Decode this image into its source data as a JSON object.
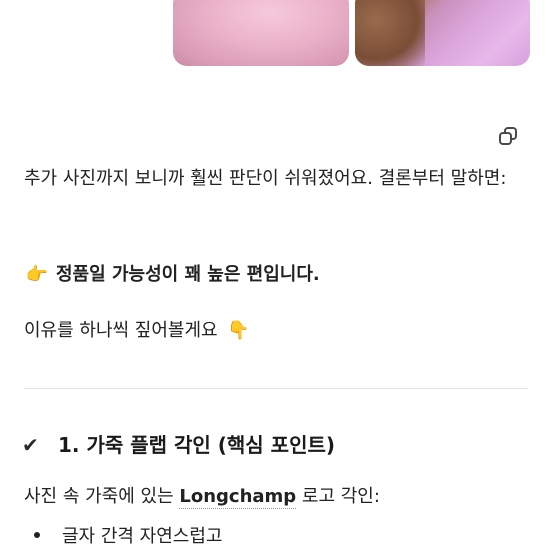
{
  "photos": [
    {
      "alt": "pink bag close-up"
    },
    {
      "alt": "hand holding pink bag"
    }
  ],
  "message": {
    "copy_icon": "copy-icon",
    "intro": "추가 사진까지 보니까 훨씬 판단이 쉬워졌어요. 결론부터 말하면:",
    "verdict_emoji": "👉",
    "verdict": "정품일 가능성이 꽤 높은 편입니다.",
    "reasons_intro": "이유를 하나씩 짚어볼게요",
    "reasons_emoji": "👇",
    "section_check": "✔",
    "section_title": "1. 가죽 플랩 각인 (핵심 포인트)",
    "section_text_before": "사진 속 가죽에 있는 ",
    "section_text_brand": "Longchamp",
    "section_text_after": " 로고 각인:",
    "bullets": [
      "글자 간격 자연스럽고"
    ]
  }
}
